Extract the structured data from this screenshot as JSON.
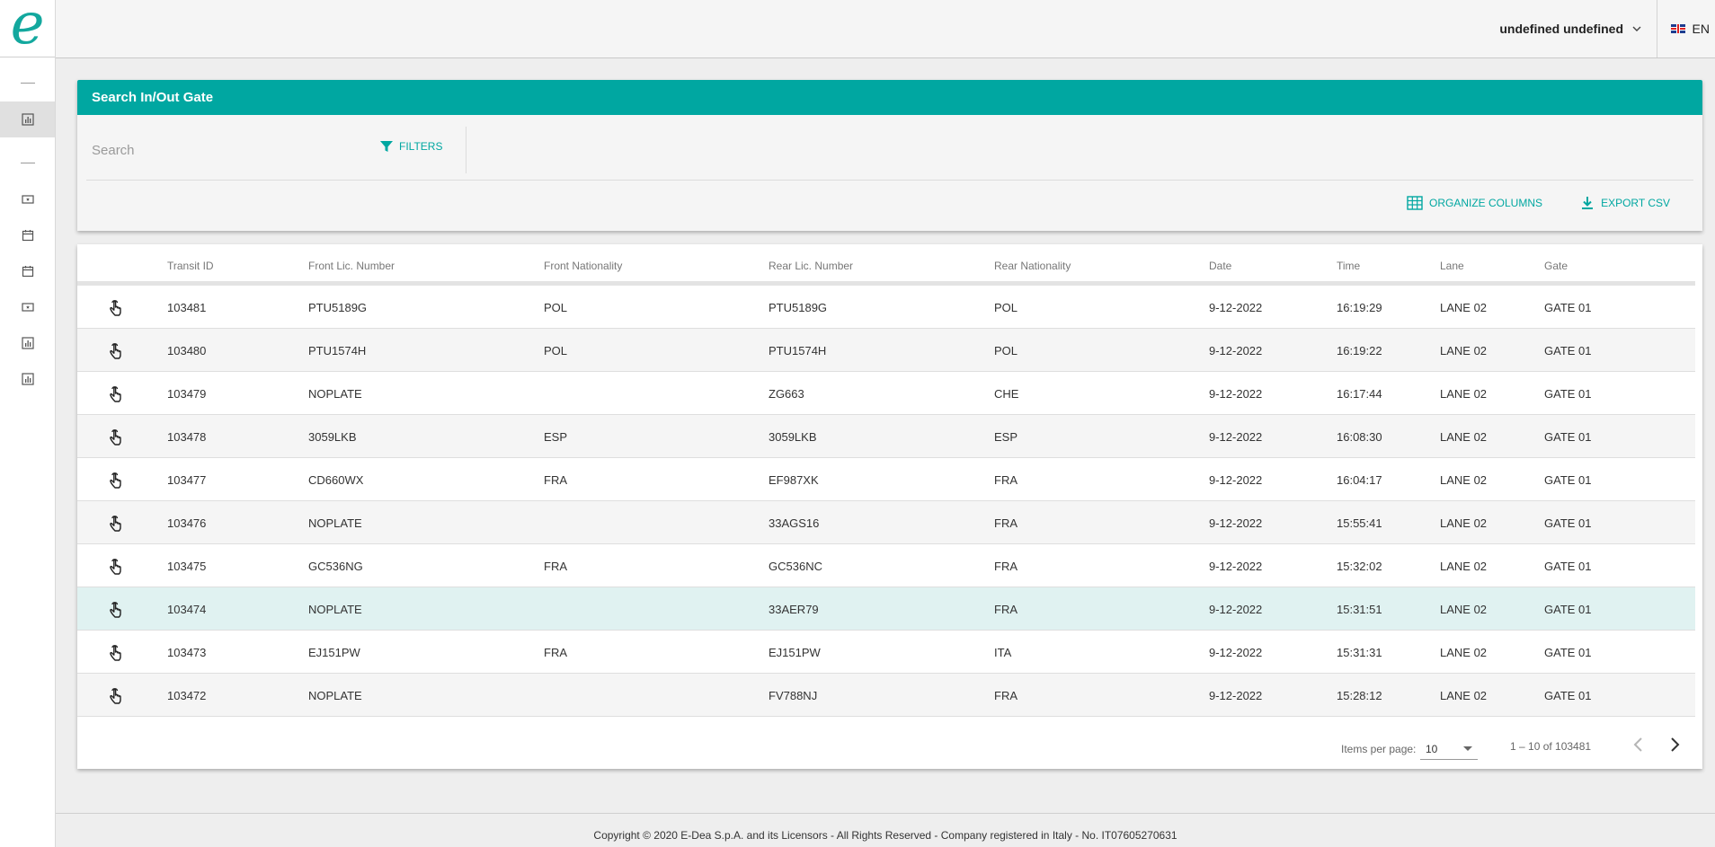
{
  "logo": {
    "letter": "e"
  },
  "topbar": {
    "user_name": "undefined undefined",
    "language": "EN"
  },
  "search_card": {
    "title": "Search In/Out Gate",
    "search_placeholder": "Search",
    "filters_label": "FILTERS",
    "organize_label": "ORGANIZE COLUMNS",
    "export_label": "EXPORT CSV"
  },
  "table": {
    "columns": [
      "Transit ID",
      "Front Lic. Number",
      "Front Nationality",
      "Rear Lic. Number",
      "Rear Nationality",
      "Date",
      "Time",
      "Lane",
      "Gate"
    ],
    "rows": [
      {
        "transit_id": "103481",
        "front_plate": "PTU5189G",
        "front_nat": "POL",
        "rear_plate": "PTU5189G",
        "rear_nat": "POL",
        "date": "9-12-2022",
        "time": "16:19:29",
        "lane": "LANE 02",
        "gate": "GATE 01"
      },
      {
        "transit_id": "103480",
        "front_plate": "PTU1574H",
        "front_nat": "POL",
        "rear_plate": "PTU1574H",
        "rear_nat": "POL",
        "date": "9-12-2022",
        "time": "16:19:22",
        "lane": "LANE 02",
        "gate": "GATE 01"
      },
      {
        "transit_id": "103479",
        "front_plate": "NOPLATE",
        "front_nat": "",
        "rear_plate": "ZG663",
        "rear_nat": "CHE",
        "date": "9-12-2022",
        "time": "16:17:44",
        "lane": "LANE 02",
        "gate": "GATE 01"
      },
      {
        "transit_id": "103478",
        "front_plate": "3059LKB",
        "front_nat": "ESP",
        "rear_plate": "3059LKB",
        "rear_nat": "ESP",
        "date": "9-12-2022",
        "time": "16:08:30",
        "lane": "LANE 02",
        "gate": "GATE 01"
      },
      {
        "transit_id": "103477",
        "front_plate": "CD660WX",
        "front_nat": "FRA",
        "rear_plate": "EF987XK",
        "rear_nat": "FRA",
        "date": "9-12-2022",
        "time": "16:04:17",
        "lane": "LANE 02",
        "gate": "GATE 01"
      },
      {
        "transit_id": "103476",
        "front_plate": "NOPLATE",
        "front_nat": "",
        "rear_plate": "33AGS16",
        "rear_nat": "FRA",
        "date": "9-12-2022",
        "time": "15:55:41",
        "lane": "LANE 02",
        "gate": "GATE 01"
      },
      {
        "transit_id": "103475",
        "front_plate": "GC536NG",
        "front_nat": "FRA",
        "rear_plate": "GC536NC",
        "rear_nat": "FRA",
        "date": "9-12-2022",
        "time": "15:32:02",
        "lane": "LANE 02",
        "gate": "GATE 01"
      },
      {
        "transit_id": "103474",
        "front_plate": "NOPLATE",
        "front_nat": "",
        "rear_plate": "33AER79",
        "rear_nat": "FRA",
        "date": "9-12-2022",
        "time": "15:31:51",
        "lane": "LANE 02",
        "gate": "GATE 01"
      },
      {
        "transit_id": "103473",
        "front_plate": "EJ151PW",
        "front_nat": "FRA",
        "rear_plate": "EJ151PW",
        "rear_nat": "ITA",
        "date": "9-12-2022",
        "time": "15:31:31",
        "lane": "LANE 02",
        "gate": "GATE 01"
      },
      {
        "transit_id": "103472",
        "front_plate": "NOPLATE",
        "front_nat": "",
        "rear_plate": "FV788NJ",
        "rear_nat": "FRA",
        "date": "9-12-2022",
        "time": "15:28:12",
        "lane": "LANE 02",
        "gate": "GATE 01"
      }
    ]
  },
  "pagination": {
    "items_per_page_label": "Items per page:",
    "items_per_page": "10",
    "range": "1 – 10 of 103481"
  },
  "footer": {
    "copyright": "Copyright © 2020 E-Dea S.p.A. and its Licensors - All Rights Reserved - Company registered in Italy - No. IT07605270631"
  },
  "colors": {
    "accent": "#00a7a1",
    "logo": "#13a89e",
    "highlight_row": "#e0f2f1"
  }
}
